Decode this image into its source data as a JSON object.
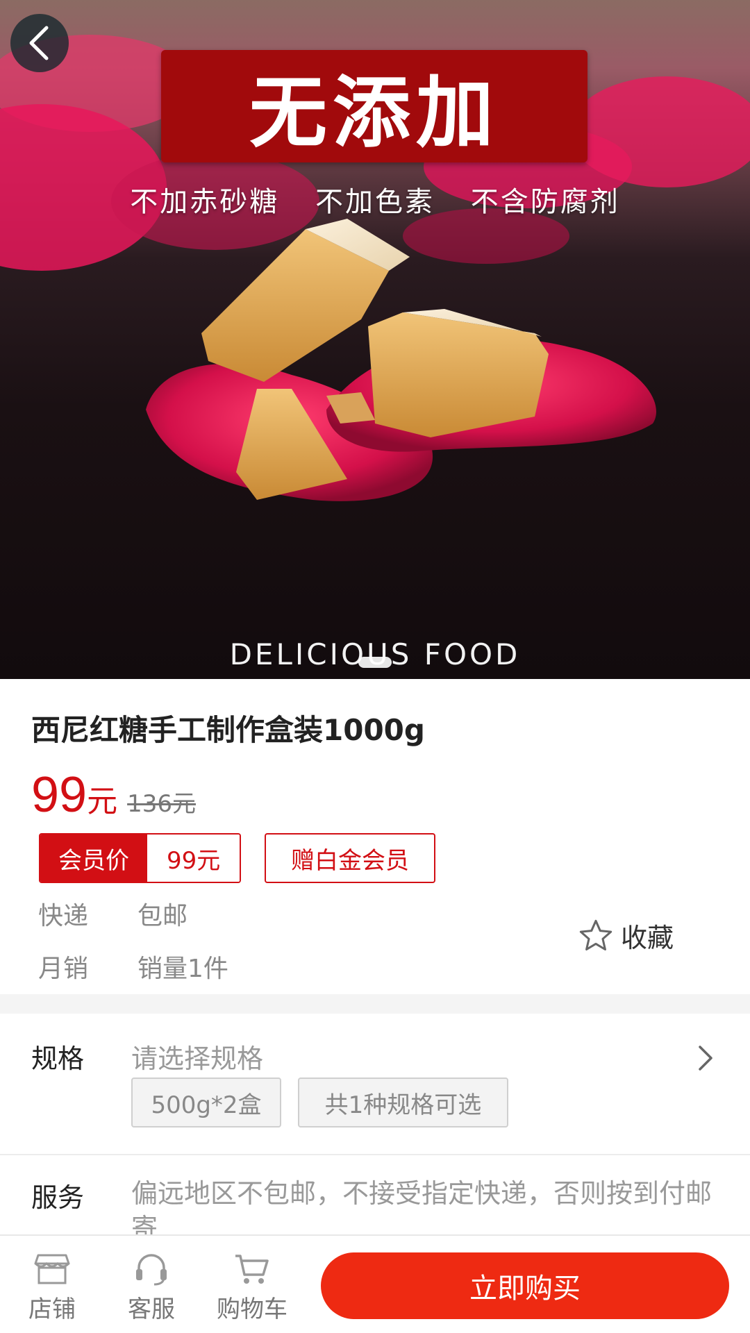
{
  "hero": {
    "banner_text": "无添加",
    "taglines": [
      "不加赤砂糖",
      "不加色素",
      "不含防腐剂"
    ],
    "caption": "DELICIOUS FOOD"
  },
  "product": {
    "title": "西尼红糖手工制作盒装1000g",
    "price": "99",
    "price_unit": "元",
    "original_price": "136元",
    "member_label": "会员价",
    "member_price": "99元",
    "gift_label": "赠白金会员",
    "shipping_key": "快递",
    "shipping_value": "包邮",
    "sales_key": "月销",
    "sales_value": "销量1件",
    "favorite_label": "收藏"
  },
  "spec": {
    "label": "规格",
    "hint": "请选择规格",
    "chips": [
      "500g*2盒",
      "共1种规格可选"
    ]
  },
  "service": {
    "label": "服务",
    "text": "偏远地区不包邮，不接受指定快递，否则按到付邮寄"
  },
  "bottombar": {
    "tabs": [
      {
        "label": "店铺",
        "icon": "store-icon"
      },
      {
        "label": "客服",
        "icon": "headset-icon"
      },
      {
        "label": "购物车",
        "icon": "cart-icon"
      }
    ],
    "buy_label": "立即购买"
  },
  "colors": {
    "accent": "#d20f14",
    "buy_button": "#ee2a12",
    "banner": "#a10a0c"
  }
}
